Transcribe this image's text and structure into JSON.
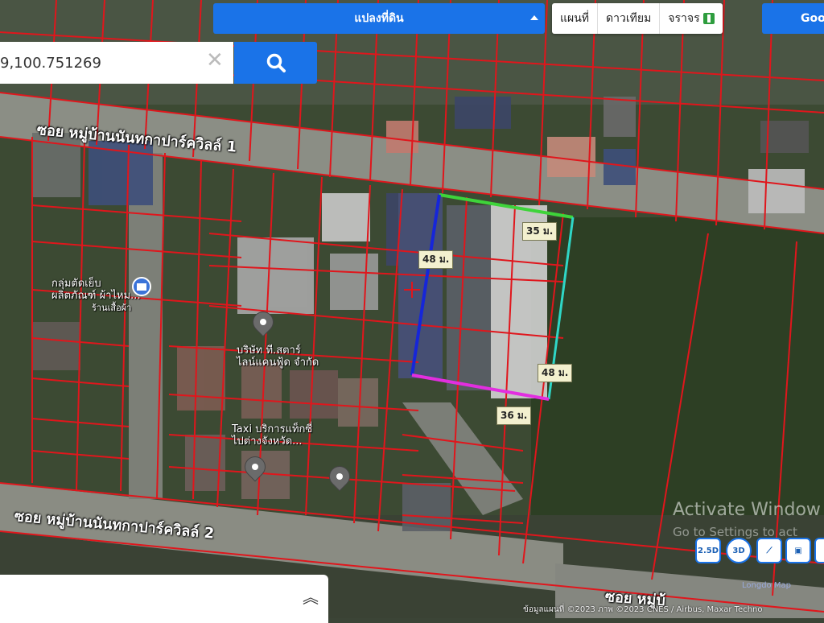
{
  "toolbar": {
    "parcel_label": "แปลงที่ดิน",
    "map_types": [
      "แผนที่",
      "ดาวเทียม",
      "จราจร"
    ],
    "google_label": "Goo"
  },
  "search": {
    "value": "9,100.751269"
  },
  "roads": {
    "road1": "ซอย หมู่บ้านนันทกาปาร์ควิลล์ 1",
    "road2": "ซอย หมู่บ้านนันทกาปาร์ควิลล์ 2",
    "road3": "ซอย หมู่บ้"
  },
  "pois": [
    {
      "line1": "กลุ่มตัดเย็บ",
      "line2": "ผลิตภัณฑ์ ผ้าไหม...",
      "line3": "ร้านเสื้อผ้า"
    },
    {
      "line1": "บริษัท ที.สตาร์",
      "line2": "ไลน์แคนฟู้ด จำกัด"
    },
    {
      "line1": "Taxi บริการแท็กซี่",
      "line2": "ไปต่างจังหวัด..."
    }
  ],
  "dimensions": {
    "top": "35 ม.",
    "left": "48 ม.",
    "right": "48 ม.",
    "bottom": "36 ม."
  },
  "view_controls": [
    "2.5D",
    "3D"
  ],
  "watermark": {
    "title": "Activate Window",
    "subtitle": "Go to Settings to act"
  },
  "attribution": {
    "copyright": "ข้อมูลแผนที่ ©2023 ภาพ ©2023 CNES / Airbus, Maxar Techno",
    "legend": "Longdo Map"
  },
  "colors": {
    "parcel_lines": "#e0161c",
    "boundary_top": "#3ed43a",
    "boundary_left": "#1626d9",
    "boundary_right": "#2fd6c6",
    "boundary_bottom": "#e22ee0",
    "accent": "#1a73e8"
  }
}
